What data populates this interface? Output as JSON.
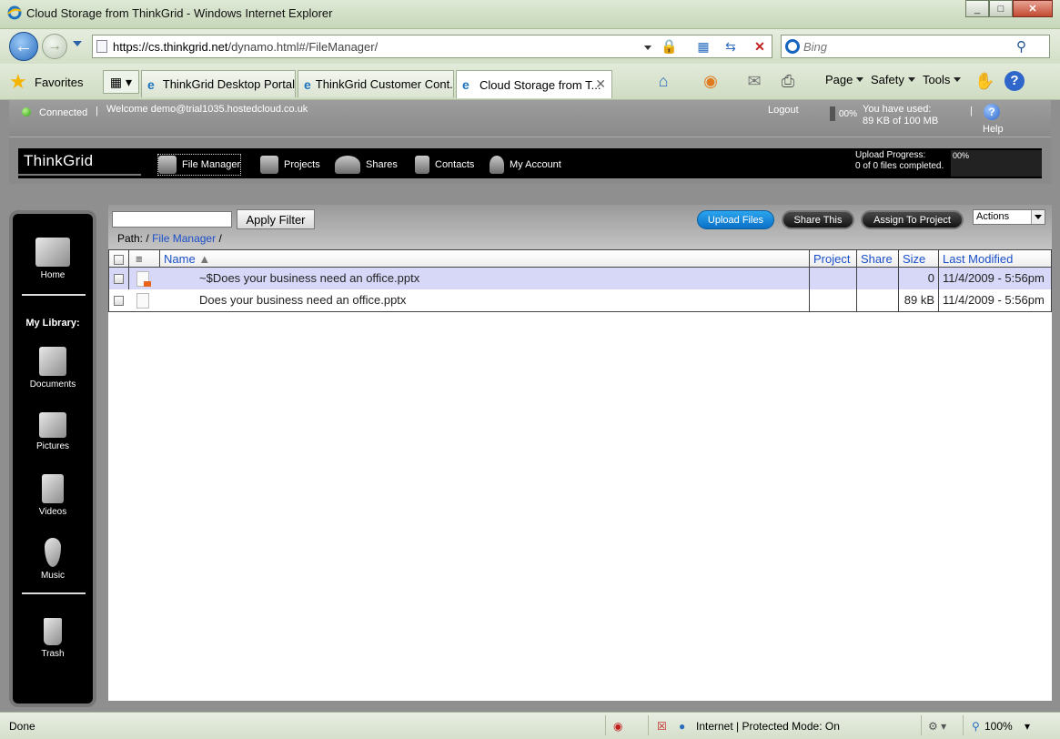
{
  "window": {
    "title": "Cloud Storage from ThinkGrid - Windows Internet Explorer",
    "minimize": "_",
    "maximize": "□",
    "close": "✕"
  },
  "browser": {
    "url_host": "https://cs.thinkgrid.net",
    "url_path": "/dynamo.html#/FileManager/",
    "search_placeholder": "Bing",
    "favorites": "Favorites",
    "tabs": [
      {
        "label": "ThinkGrid Desktop Portal"
      },
      {
        "label": "ThinkGrid Customer Cont..."
      },
      {
        "label": "Cloud Storage from T..."
      }
    ],
    "commands": {
      "page": "Page",
      "safety": "Safety",
      "tools": "Tools"
    }
  },
  "app": {
    "status": {
      "connected": "Connected",
      "welcome": "Welcome demo@trial1035.hostedcloud.co.uk",
      "logout": "Logout",
      "usage_pct": "00%",
      "usage_line1": "You have used:",
      "usage_line2": "89 KB of 100 MB",
      "help": "Help"
    },
    "brand": "ThinkGrid",
    "nav": [
      {
        "label": "File Manager"
      },
      {
        "label": "Projects"
      },
      {
        "label": "Shares"
      },
      {
        "label": "Contacts"
      },
      {
        "label": "My Account"
      }
    ],
    "upload": {
      "label": "Upload Progress:",
      "files": "0 of 0 files completed.",
      "pct": "00%",
      "progress": 0
    },
    "sidebar": {
      "home": "Home",
      "library_heading": "My Library:",
      "items": [
        {
          "label": "Documents"
        },
        {
          "label": "Pictures"
        },
        {
          "label": "Videos"
        },
        {
          "label": "Music"
        }
      ],
      "trash": "Trash"
    },
    "toolbar": {
      "filter_value": "",
      "apply_filter": "Apply Filter",
      "upload_files": "Upload Files",
      "share_this": "Share This",
      "assign_to_project": "Assign To Project",
      "actions": "Actions"
    },
    "path": {
      "label": "Path:",
      "root": "/",
      "current": "File Manager",
      "trailing": "/"
    },
    "grid": {
      "columns": {
        "name": "Name",
        "project": "Project",
        "share": "Share",
        "size": "Size",
        "modified": "Last Modified"
      },
      "rows": [
        {
          "name": "~$Does your business need an office.pptx",
          "project": "",
          "share": "",
          "size": "0",
          "modified": "11/4/2009 - 5:56pm"
        },
        {
          "name": "Does your business need an office.pptx",
          "project": "",
          "share": "",
          "size": "89 kB",
          "modified": "11/4/2009 - 5:56pm"
        }
      ]
    }
  },
  "statusbar": {
    "done": "Done",
    "zone": "Internet | Protected Mode: On",
    "zoom": "100%"
  }
}
